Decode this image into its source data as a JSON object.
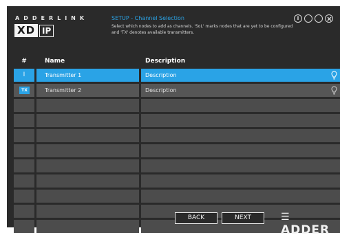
{
  "brand": {
    "top": "ADDERLINK",
    "xd": "XD",
    "ip": "IP"
  },
  "header": {
    "title": "SETUP - Channel Selection",
    "description": "Select which nodes to add as channels. 'SoL' marks nodes that are yet to be configured and 'TX' denotes available transmitters."
  },
  "window_controls": {
    "info": "i"
  },
  "table": {
    "columns": [
      "#",
      "Name",
      "Description"
    ],
    "rows": [
      {
        "num": "I",
        "name": "Transmitter 1",
        "description": "Description",
        "selected": true
      },
      {
        "num": "TX",
        "name": "Transmitter 2",
        "description": "Description",
        "selected": false
      }
    ]
  },
  "buttons": {
    "back": "BACK",
    "next": "NEXT"
  },
  "logo": {
    "text": "ADDER"
  },
  "colors": {
    "accent": "#2aa3e6",
    "panel": "#2a2a2a",
    "row": "#565656"
  }
}
